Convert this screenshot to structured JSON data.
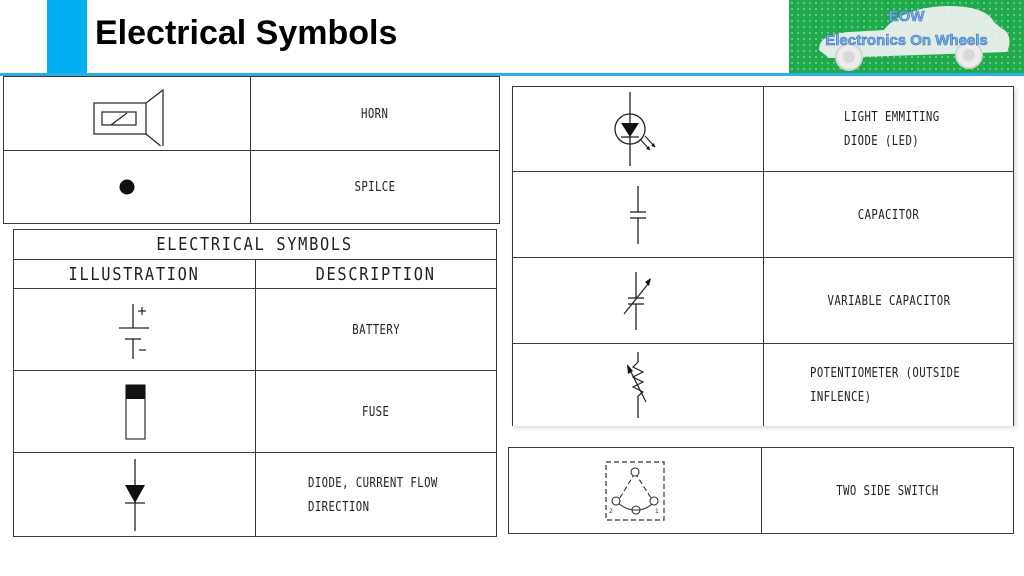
{
  "header": {
    "title": "Electrical Symbols",
    "accent_color": "#00b0f0",
    "rule_color": "#29aee6"
  },
  "logo": {
    "line1": "EOW",
    "line2": "Electronics On Wheels",
    "background_color": "#1faa4c",
    "icon": "car-icon"
  },
  "table_top_left": {
    "rows": [
      {
        "symbol": "horn-symbol",
        "description": "HORN"
      },
      {
        "symbol": "splice-symbol",
        "description": "SPILCE"
      }
    ]
  },
  "table_main_left": {
    "title": "ELECTRICAL SYMBOLS",
    "columns": [
      "ILLUSTRATION",
      "DESCRIPTION"
    ],
    "rows": [
      {
        "symbol": "battery-symbol",
        "description": "BATTERY"
      },
      {
        "symbol": "fuse-symbol",
        "description": "FUSE"
      },
      {
        "symbol": "diode-symbol",
        "description_line1": "DIODE, CURRENT FLOW",
        "description_line2": "DIRECTION"
      }
    ]
  },
  "table_right": {
    "rows": [
      {
        "symbol": "led-symbol",
        "description_line1": "LIGHT EMMITING",
        "description_line2": "DIODE (LED)"
      },
      {
        "symbol": "capacitor-symbol",
        "description": "CAPACITOR"
      },
      {
        "symbol": "variable-capacitor-symbol",
        "description": "VARIABLE CAPACITOR"
      },
      {
        "symbol": "potentiometer-symbol",
        "description_line1": "POTENTIOMETER (OUTSIDE",
        "description_line2": "INFLENCE)"
      }
    ]
  },
  "table_bottom_right": {
    "rows": [
      {
        "symbol": "two-side-switch-symbol",
        "description": "TWO SIDE SWITCH",
        "terminal_labels": [
          "2",
          "1"
        ]
      }
    ]
  }
}
